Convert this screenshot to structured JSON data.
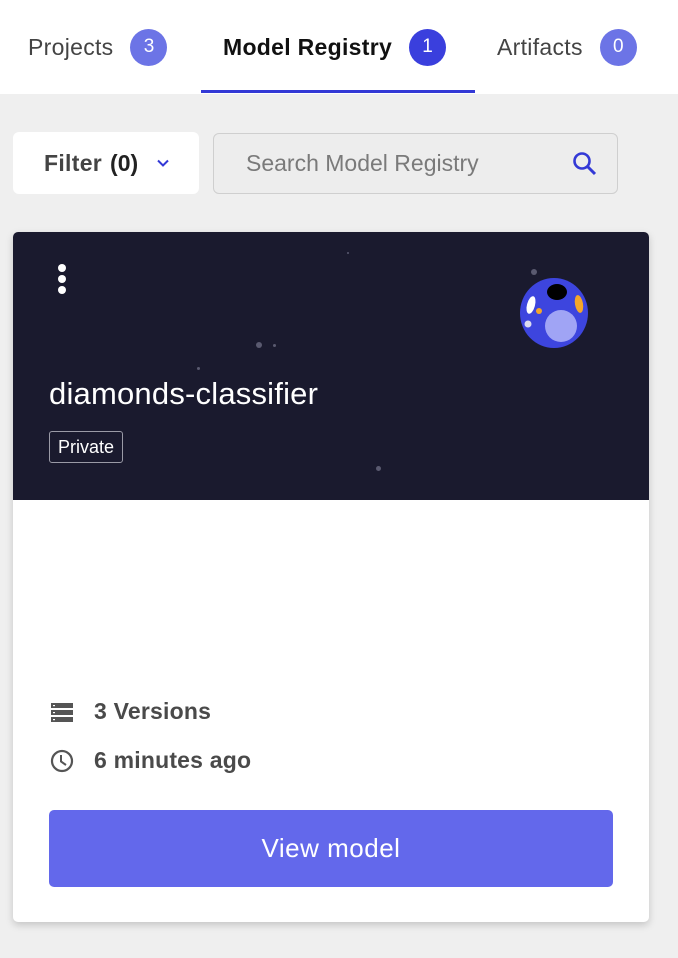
{
  "tabs": [
    {
      "label": "Projects",
      "count": "3",
      "active": false
    },
    {
      "label": "Model Registry",
      "count": "1",
      "active": true
    },
    {
      "label": "Artifacts",
      "count": "0",
      "active": false
    }
  ],
  "toolbar": {
    "filter_label": "Filter",
    "filter_count": "(0)",
    "search_placeholder": "Search Model Registry"
  },
  "model_card": {
    "name": "diamonds-classifier",
    "visibility": "Private",
    "versions": "3 Versions",
    "updated": "6 minutes ago",
    "view_button": "View model"
  },
  "colors": {
    "accent": "#3a3fdd",
    "badge": "#6c74e6",
    "button": "#6368eb",
    "card_header": "#1a1a2e"
  }
}
